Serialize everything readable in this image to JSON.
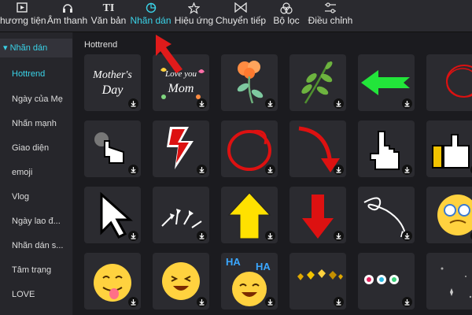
{
  "toolbar": {
    "tabs": [
      {
        "label": "hương tiện",
        "icon": "media-icon"
      },
      {
        "label": "Âm thanh",
        "icon": "audio-icon"
      },
      {
        "label": "Văn bản",
        "icon": "text-icon"
      },
      {
        "label": "Nhãn dán",
        "icon": "sticker-icon",
        "active": true
      },
      {
        "label": "Hiệu ứng",
        "icon": "effects-icon"
      },
      {
        "label": "Chuyển tiếp",
        "icon": "transition-icon"
      },
      {
        "label": "Bộ lọc",
        "icon": "filter-icon"
      },
      {
        "label": "Điều chỉnh",
        "icon": "adjust-icon"
      }
    ]
  },
  "sidebar": {
    "header": "▾ Nhãn dán",
    "items": [
      "Hottrend",
      "Ngày của Mẹ",
      "Nhấn mạnh",
      "Giao diện",
      "emoji",
      "Vlog",
      "Ngày lao đ...",
      "Nhãn dán s...",
      "Tâm trạng",
      "LOVE"
    ],
    "active_index": 0
  },
  "main": {
    "section_title": "Hottrend",
    "stickers": [
      {
        "name": "mothers-day-text",
        "text": "Mother's Day"
      },
      {
        "name": "love-you-mom-text",
        "text": "Love you Mom"
      },
      {
        "name": "orange-flower"
      },
      {
        "name": "green-leaf-branch"
      },
      {
        "name": "green-arrow-left"
      },
      {
        "name": "red-circle-scribble"
      },
      {
        "name": "pointer-hand-click"
      },
      {
        "name": "red-zigzag-arrow-down"
      },
      {
        "name": "red-circle-scribble-2"
      },
      {
        "name": "red-curved-arrow"
      },
      {
        "name": "pixel-hand-cursor"
      },
      {
        "name": "pixel-thumbs-up"
      },
      {
        "name": "pixel-arrow-cursor"
      },
      {
        "name": "white-sketch-arrows"
      },
      {
        "name": "yellow-arrow-up"
      },
      {
        "name": "red-arrow-down"
      },
      {
        "name": "white-loop-arrow"
      },
      {
        "name": "dizzy-emoji"
      },
      {
        "name": "tongue-out-emoji"
      },
      {
        "name": "laughing-emoji"
      },
      {
        "name": "haha-emoji",
        "text": "HA HA"
      },
      {
        "name": "gold-hearts"
      },
      {
        "name": "colorful-circles"
      },
      {
        "name": "sparkle-dots"
      }
    ]
  },
  "colors": {
    "accent": "#3ad3e8",
    "annotation": "#e01b1b"
  }
}
